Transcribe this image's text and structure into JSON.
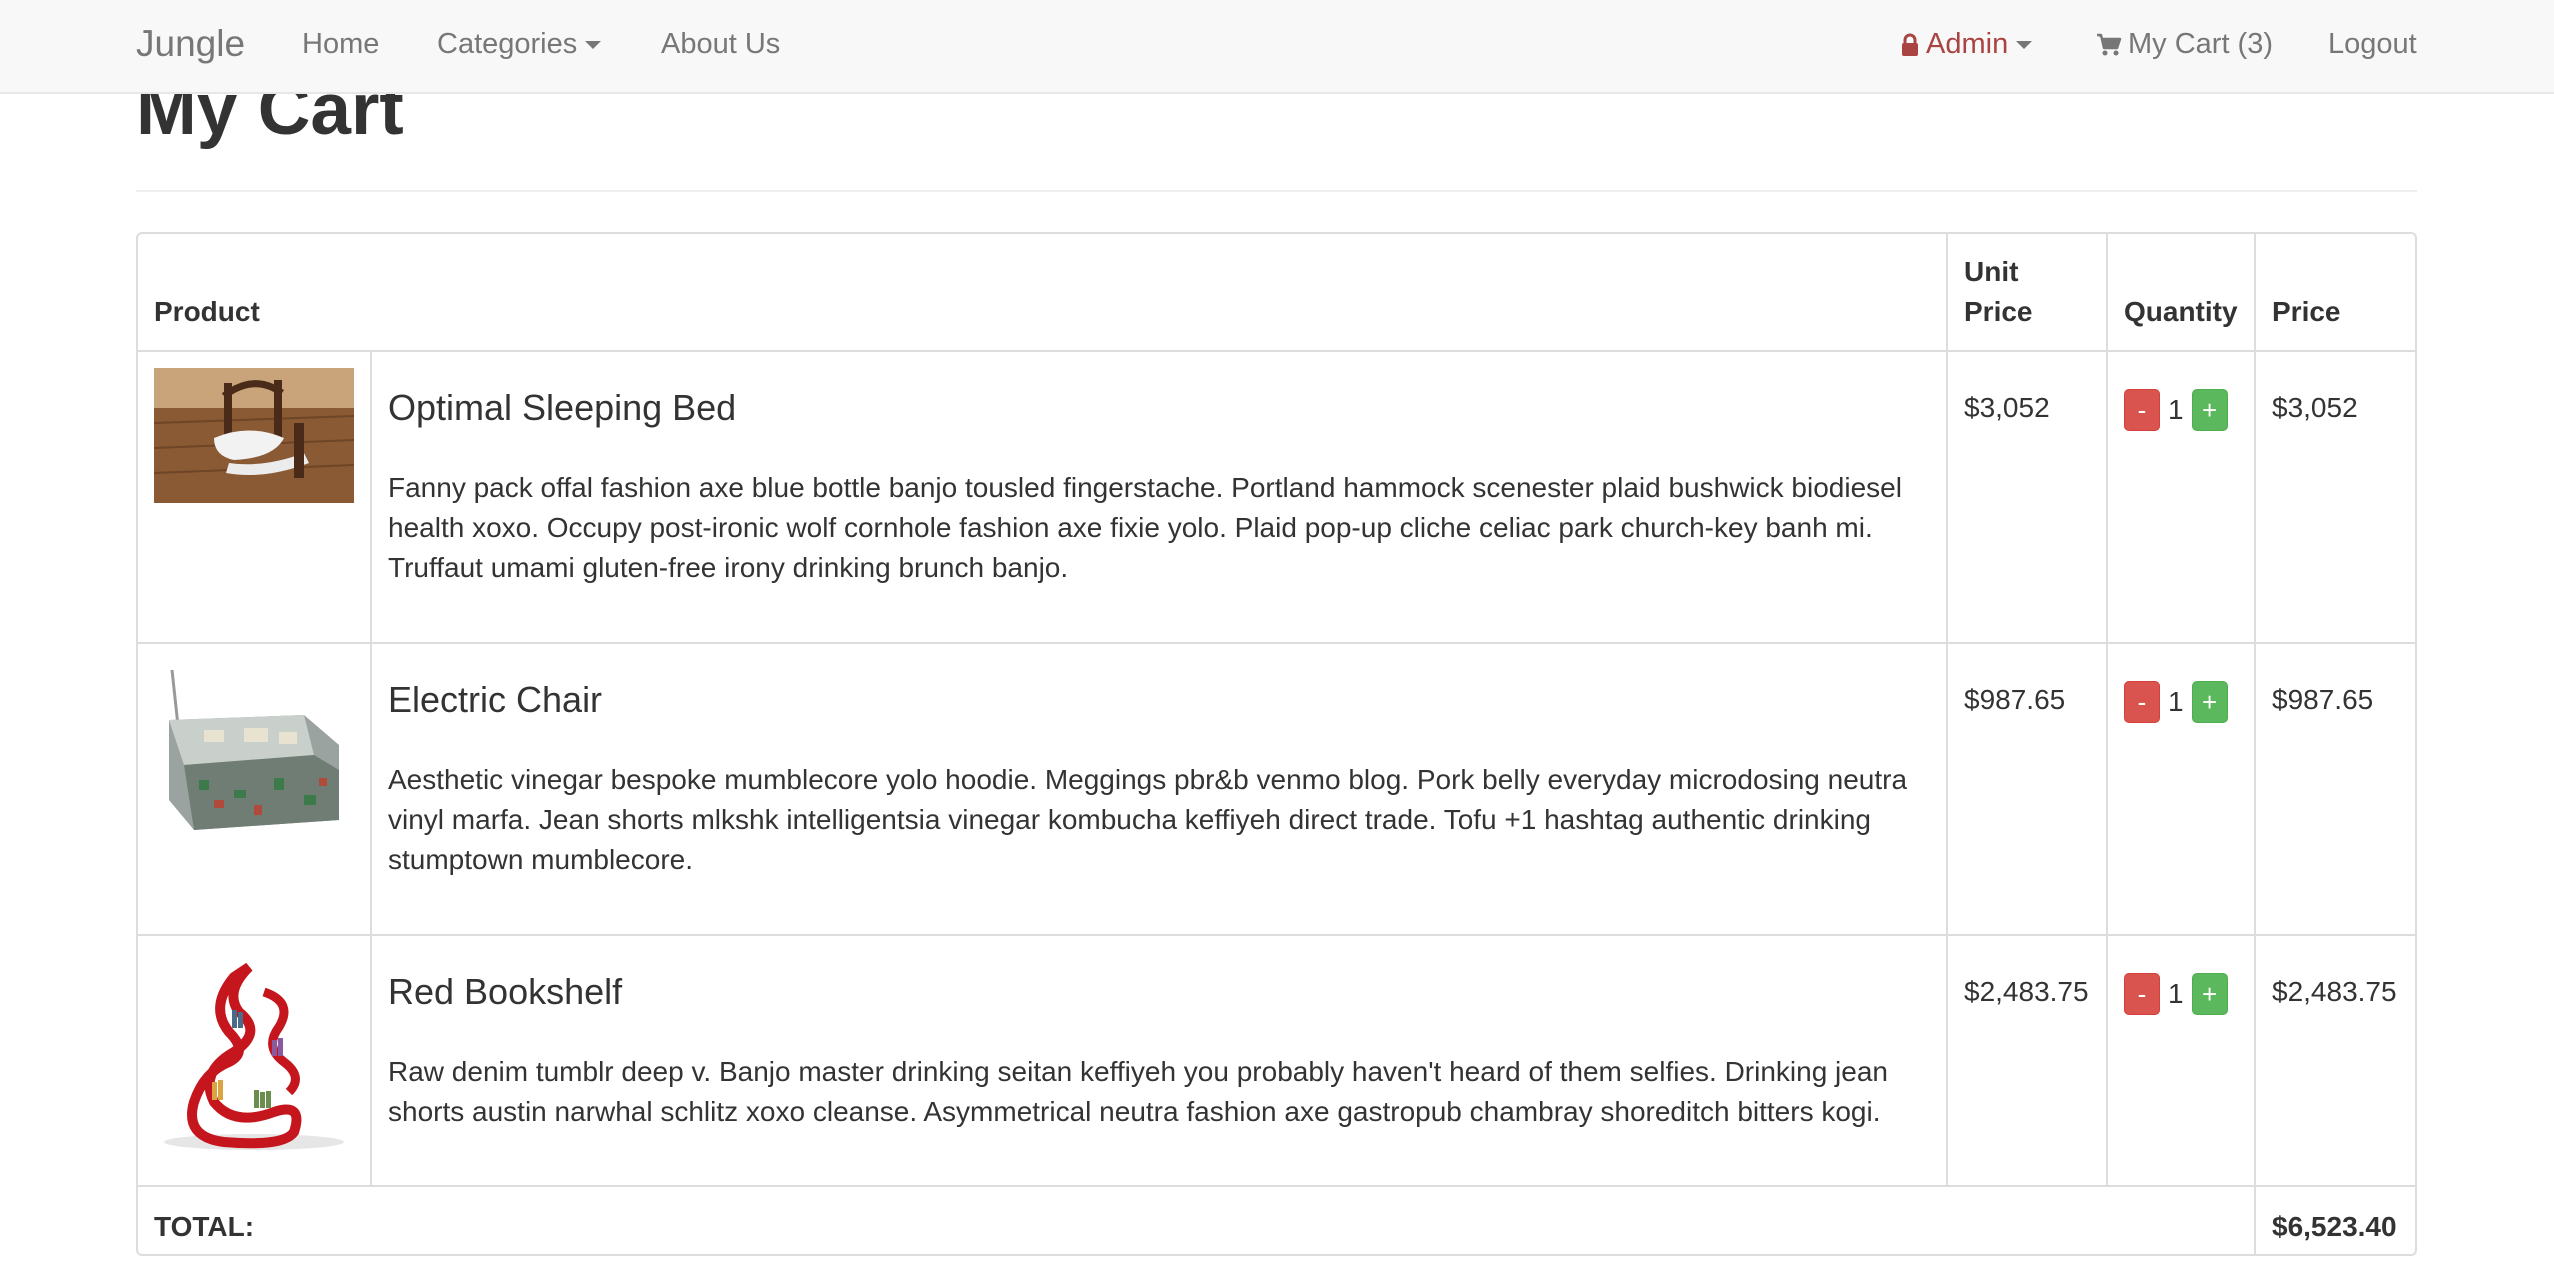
{
  "navbar": {
    "brand": "Jungle",
    "home": "Home",
    "categories": "Categories",
    "about": "About Us",
    "admin": "Admin",
    "cart": "My Cart (3)",
    "logout": "Logout"
  },
  "page": {
    "title": "My Cart"
  },
  "table": {
    "headers": {
      "product": "Product",
      "unit_price": "Unit Price",
      "quantity": "Quantity",
      "price": "Price"
    },
    "items": [
      {
        "name": "Optimal Sleeping Bed",
        "description": "Fanny pack offal fashion axe blue bottle banjo tousled fingerstache. Portland hammock scenester plaid bushwick biodiesel health xoxo. Occupy post-ironic wolf cornhole fashion axe fixie yolo. Plaid pop-up cliche celiac park church-key banh mi. Truffaut umami gluten-free irony drinking brunch banjo.",
        "unit_price": "$3,052",
        "quantity": "1",
        "price": "$3,052",
        "minus": "-",
        "plus": "+"
      },
      {
        "name": "Electric Chair",
        "description": "Aesthetic vinegar bespoke mumblecore yolo hoodie. Meggings pbr&b venmo blog. Pork belly everyday microdosing neutra vinyl marfa. Jean shorts mlkshk intelligentsia vinegar kombucha keffiyeh direct trade. Tofu +1 hashtag authentic drinking stumptown mumblecore.",
        "unit_price": "$987.65",
        "quantity": "1",
        "price": "$987.65",
        "minus": "-",
        "plus": "+"
      },
      {
        "name": "Red Bookshelf",
        "description": "Raw denim tumblr deep v. Banjo master drinking seitan keffiyeh you probably haven't heard of them selfies. Drinking jean shorts austin narwhal schlitz xoxo cleanse. Asymmetrical neutra fashion axe gastropub chambray shoreditch bitters kogi.",
        "unit_price": "$2,483.75",
        "quantity": "1",
        "price": "$2,483.75",
        "minus": "-",
        "plus": "+"
      }
    ],
    "total_label": "TOTAL:",
    "total_value": "$6,523.40"
  },
  "colors": {
    "danger": "#d9534f",
    "success": "#5cb85c",
    "admin": "#a94442",
    "nav_text": "#777777"
  },
  "icons": {
    "admin": "lock-icon",
    "cart": "shopping-cart-icon"
  }
}
